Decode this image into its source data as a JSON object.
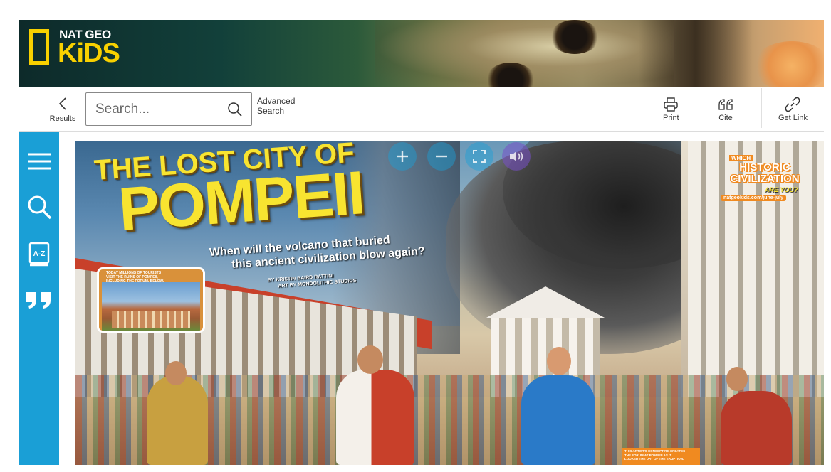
{
  "brand": {
    "line1": "NAT GEO",
    "line2": "KiDS",
    "accent": "#f8d000"
  },
  "toolbar": {
    "results_label": "Results",
    "search_placeholder": "Search...",
    "advanced_search": [
      "Advanced",
      "Search"
    ],
    "print_label": "Print",
    "cite_label": "Cite",
    "get_link_label": "Get Link"
  },
  "sidebar": {
    "color": "#1a9fd6",
    "items": [
      {
        "icon": "menu-icon"
      },
      {
        "icon": "search-icon"
      },
      {
        "icon": "a-z-book-icon",
        "label": "A-Z"
      },
      {
        "icon": "quote-icon"
      }
    ]
  },
  "viewer": {
    "controls": [
      "zoom-in-icon",
      "zoom-out-icon",
      "fullscreen-icon",
      "audio-icon"
    ],
    "article": {
      "title_line1": "THE LOST CITY OF",
      "title_line2": "POMPEII",
      "subtitle_line1": "When will the volcano that buried",
      "subtitle_line2": "this ancient civilization blow again?",
      "byline_1": "BY KRISTIN BAIRD RATTINI",
      "byline_2": "ART BY MONDOLITHIC STUDIOS",
      "inset_caption": [
        "TODAY MILLIONS OF TOURISTS",
        "VISIT THE RUINS OF POMPEII,",
        "INCLUDING THE FORUM, BELOW."
      ],
      "promo": {
        "which": "WHICH",
        "historic": "HISTORIC",
        "civilization": "CIVILIZATION",
        "are_you": "ARE YOU?",
        "url": "natgeokids.com/june-july"
      },
      "bottom_caption": [
        "THIS ARTIST'S CONCEPT RE-CREATES",
        "THE FORUM AT POMPEII AS IT",
        "LOOKED THE DAY OF THE ERUPTION."
      ]
    }
  }
}
